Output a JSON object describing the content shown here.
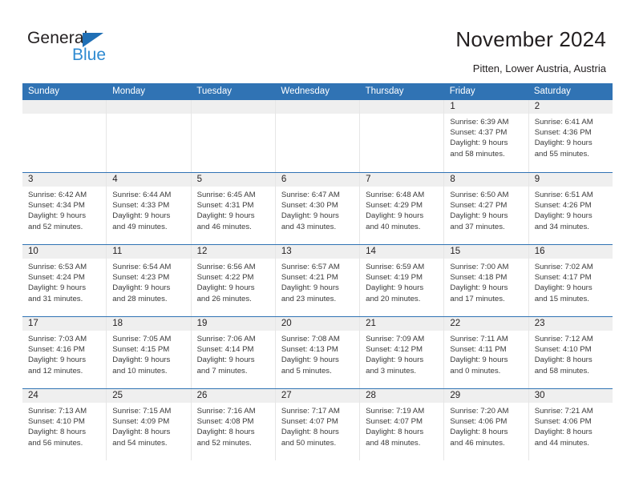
{
  "brand": {
    "name_part1": "General",
    "name_part2": "Blue",
    "triangle_color": "#1f6fb5",
    "blue_text_color": "#2e8ad1"
  },
  "header": {
    "title": "November 2024",
    "subtitle": "Pitten, Lower Austria, Austria",
    "header_bar_color": "#3073b4"
  },
  "weekdays": [
    "Sunday",
    "Monday",
    "Tuesday",
    "Wednesday",
    "Thursday",
    "Friday",
    "Saturday"
  ],
  "weeks": [
    [
      {
        "day": "",
        "empty": true
      },
      {
        "day": "",
        "empty": true
      },
      {
        "day": "",
        "empty": true
      },
      {
        "day": "",
        "empty": true
      },
      {
        "day": "",
        "empty": true
      },
      {
        "day": "1",
        "sunrise": "Sunrise: 6:39 AM",
        "sunset": "Sunset: 4:37 PM",
        "daylight1": "Daylight: 9 hours",
        "daylight2": "and 58 minutes."
      },
      {
        "day": "2",
        "sunrise": "Sunrise: 6:41 AM",
        "sunset": "Sunset: 4:36 PM",
        "daylight1": "Daylight: 9 hours",
        "daylight2": "and 55 minutes."
      }
    ],
    [
      {
        "day": "3",
        "sunrise": "Sunrise: 6:42 AM",
        "sunset": "Sunset: 4:34 PM",
        "daylight1": "Daylight: 9 hours",
        "daylight2": "and 52 minutes."
      },
      {
        "day": "4",
        "sunrise": "Sunrise: 6:44 AM",
        "sunset": "Sunset: 4:33 PM",
        "daylight1": "Daylight: 9 hours",
        "daylight2": "and 49 minutes."
      },
      {
        "day": "5",
        "sunrise": "Sunrise: 6:45 AM",
        "sunset": "Sunset: 4:31 PM",
        "daylight1": "Daylight: 9 hours",
        "daylight2": "and 46 minutes."
      },
      {
        "day": "6",
        "sunrise": "Sunrise: 6:47 AM",
        "sunset": "Sunset: 4:30 PM",
        "daylight1": "Daylight: 9 hours",
        "daylight2": "and 43 minutes."
      },
      {
        "day": "7",
        "sunrise": "Sunrise: 6:48 AM",
        "sunset": "Sunset: 4:29 PM",
        "daylight1": "Daylight: 9 hours",
        "daylight2": "and 40 minutes."
      },
      {
        "day": "8",
        "sunrise": "Sunrise: 6:50 AM",
        "sunset": "Sunset: 4:27 PM",
        "daylight1": "Daylight: 9 hours",
        "daylight2": "and 37 minutes."
      },
      {
        "day": "9",
        "sunrise": "Sunrise: 6:51 AM",
        "sunset": "Sunset: 4:26 PM",
        "daylight1": "Daylight: 9 hours",
        "daylight2": "and 34 minutes."
      }
    ],
    [
      {
        "day": "10",
        "sunrise": "Sunrise: 6:53 AM",
        "sunset": "Sunset: 4:24 PM",
        "daylight1": "Daylight: 9 hours",
        "daylight2": "and 31 minutes."
      },
      {
        "day": "11",
        "sunrise": "Sunrise: 6:54 AM",
        "sunset": "Sunset: 4:23 PM",
        "daylight1": "Daylight: 9 hours",
        "daylight2": "and 28 minutes."
      },
      {
        "day": "12",
        "sunrise": "Sunrise: 6:56 AM",
        "sunset": "Sunset: 4:22 PM",
        "daylight1": "Daylight: 9 hours",
        "daylight2": "and 26 minutes."
      },
      {
        "day": "13",
        "sunrise": "Sunrise: 6:57 AM",
        "sunset": "Sunset: 4:21 PM",
        "daylight1": "Daylight: 9 hours",
        "daylight2": "and 23 minutes."
      },
      {
        "day": "14",
        "sunrise": "Sunrise: 6:59 AM",
        "sunset": "Sunset: 4:19 PM",
        "daylight1": "Daylight: 9 hours",
        "daylight2": "and 20 minutes."
      },
      {
        "day": "15",
        "sunrise": "Sunrise: 7:00 AM",
        "sunset": "Sunset: 4:18 PM",
        "daylight1": "Daylight: 9 hours",
        "daylight2": "and 17 minutes."
      },
      {
        "day": "16",
        "sunrise": "Sunrise: 7:02 AM",
        "sunset": "Sunset: 4:17 PM",
        "daylight1": "Daylight: 9 hours",
        "daylight2": "and 15 minutes."
      }
    ],
    [
      {
        "day": "17",
        "sunrise": "Sunrise: 7:03 AM",
        "sunset": "Sunset: 4:16 PM",
        "daylight1": "Daylight: 9 hours",
        "daylight2": "and 12 minutes."
      },
      {
        "day": "18",
        "sunrise": "Sunrise: 7:05 AM",
        "sunset": "Sunset: 4:15 PM",
        "daylight1": "Daylight: 9 hours",
        "daylight2": "and 10 minutes."
      },
      {
        "day": "19",
        "sunrise": "Sunrise: 7:06 AM",
        "sunset": "Sunset: 4:14 PM",
        "daylight1": "Daylight: 9 hours",
        "daylight2": "and 7 minutes."
      },
      {
        "day": "20",
        "sunrise": "Sunrise: 7:08 AM",
        "sunset": "Sunset: 4:13 PM",
        "daylight1": "Daylight: 9 hours",
        "daylight2": "and 5 minutes."
      },
      {
        "day": "21",
        "sunrise": "Sunrise: 7:09 AM",
        "sunset": "Sunset: 4:12 PM",
        "daylight1": "Daylight: 9 hours",
        "daylight2": "and 3 minutes."
      },
      {
        "day": "22",
        "sunrise": "Sunrise: 7:11 AM",
        "sunset": "Sunset: 4:11 PM",
        "daylight1": "Daylight: 9 hours",
        "daylight2": "and 0 minutes."
      },
      {
        "day": "23",
        "sunrise": "Sunrise: 7:12 AM",
        "sunset": "Sunset: 4:10 PM",
        "daylight1": "Daylight: 8 hours",
        "daylight2": "and 58 minutes."
      }
    ],
    [
      {
        "day": "24",
        "sunrise": "Sunrise: 7:13 AM",
        "sunset": "Sunset: 4:10 PM",
        "daylight1": "Daylight: 8 hours",
        "daylight2": "and 56 minutes."
      },
      {
        "day": "25",
        "sunrise": "Sunrise: 7:15 AM",
        "sunset": "Sunset: 4:09 PM",
        "daylight1": "Daylight: 8 hours",
        "daylight2": "and 54 minutes."
      },
      {
        "day": "26",
        "sunrise": "Sunrise: 7:16 AM",
        "sunset": "Sunset: 4:08 PM",
        "daylight1": "Daylight: 8 hours",
        "daylight2": "and 52 minutes."
      },
      {
        "day": "27",
        "sunrise": "Sunrise: 7:17 AM",
        "sunset": "Sunset: 4:07 PM",
        "daylight1": "Daylight: 8 hours",
        "daylight2": "and 50 minutes."
      },
      {
        "day": "28",
        "sunrise": "Sunrise: 7:19 AM",
        "sunset": "Sunset: 4:07 PM",
        "daylight1": "Daylight: 8 hours",
        "daylight2": "and 48 minutes."
      },
      {
        "day": "29",
        "sunrise": "Sunrise: 7:20 AM",
        "sunset": "Sunset: 4:06 PM",
        "daylight1": "Daylight: 8 hours",
        "daylight2": "and 46 minutes."
      },
      {
        "day": "30",
        "sunrise": "Sunrise: 7:21 AM",
        "sunset": "Sunset: 4:06 PM",
        "daylight1": "Daylight: 8 hours",
        "daylight2": "and 44 minutes."
      }
    ]
  ]
}
